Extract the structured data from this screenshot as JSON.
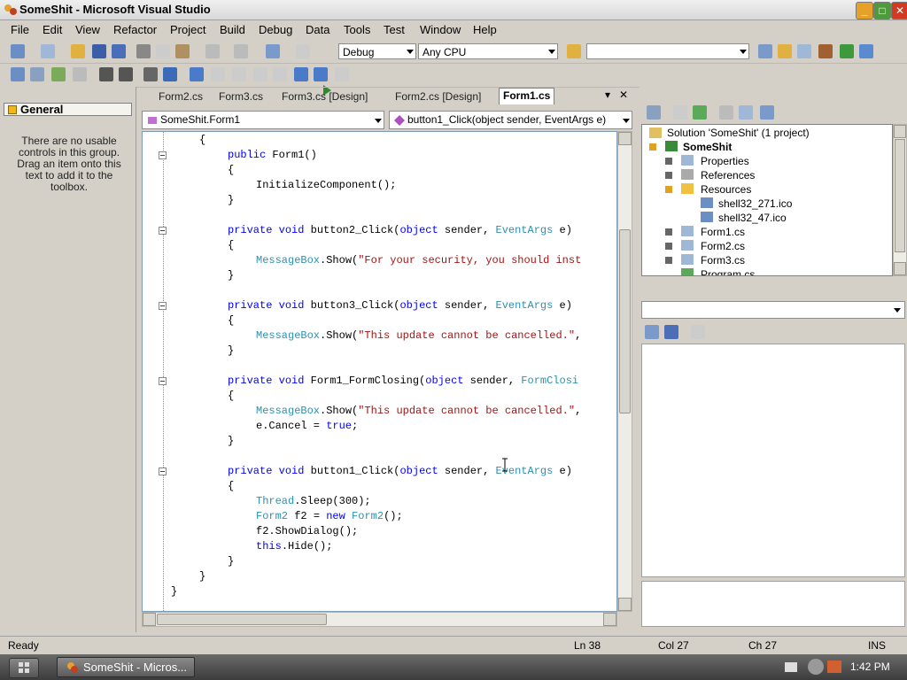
{
  "window": {
    "title": "SomeShit - Microsoft Visual Studio",
    "minimize": "_",
    "maximize": "□",
    "close": "✕"
  },
  "menu": [
    "File",
    "Edit",
    "View",
    "Refactor",
    "Project",
    "Build",
    "Debug",
    "Data",
    "Tools",
    "Test",
    "Window",
    "Help"
  ],
  "toolbar": {
    "config": "Debug",
    "platform": "Any CPU",
    "find": ""
  },
  "toolbox": {
    "header": "General",
    "empty_text": "There are no usable controls in this group. Drag an item onto this text to add it to the toolbox."
  },
  "doc_tabs": [
    "Form2.cs",
    "Form3.cs",
    "Form3.cs [Design]",
    "Form2.cs [Design]",
    "Form1.cs"
  ],
  "doc_tab_controls": {
    "dropdown": "▾",
    "close": "✕"
  },
  "editor": {
    "class_combo": "SomeShit.Form1",
    "member_combo": "button1_Click(object sender, EventArgs e)",
    "code": [
      "{",
      "public Form1()",
      "{",
      "InitializeComponent();",
      "}",
      "",
      "private void button2_Click(object sender, EventArgs e)",
      "{",
      "MessageBox.Show(\"For your security, you should inst",
      "}",
      "",
      "private void button3_Click(object sender, EventArgs e)",
      "{",
      "MessageBox.Show(\"This update cannot be cancelled.\",",
      "}",
      "",
      "private void Form1_FormClosing(object sender, FormClosi",
      "{",
      "MessageBox.Show(\"This update cannot be cancelled.\",",
      "e.Cancel = true;",
      "}",
      "",
      "private void button1_Click(object sender, EventArgs e)",
      "{",
      "Thread.Sleep(300);",
      "Form2 f2 = new Form2();",
      "f2.ShowDialog();",
      "this.Hide();",
      "}",
      "}",
      "}"
    ]
  },
  "solution": {
    "items": [
      "Solution 'SomeShit' (1 project)",
      "SomeShit",
      "Properties",
      "References",
      "Resources",
      "shell32_271.ico",
      "shell32_47.ico",
      "Form1.cs",
      "Form2.cs",
      "Form3.cs",
      "Program.cs"
    ]
  },
  "statusbar": {
    "state": "Ready",
    "ln": "Ln 38",
    "col": "Col 27",
    "ch": "Ch 27",
    "mode": "INS"
  },
  "taskbar": {
    "item": "SomeShit - Micros...",
    "clock": "1:42 PM"
  },
  "colors": {
    "keyword": "#0000ff",
    "type": "#2b91af",
    "string": "#a31515"
  }
}
